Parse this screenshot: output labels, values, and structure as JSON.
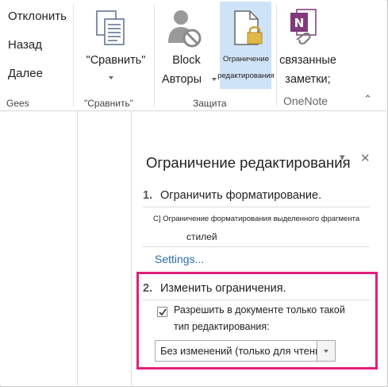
{
  "ribbon": {
    "left_commands": [
      "Отклонить",
      "Назад",
      "Далее"
    ],
    "group_gees": "Gees",
    "compare": {
      "label": "\"Сравнить\"",
      "group": "\"Сравнить\""
    },
    "block_authors": {
      "line1": "Block",
      "line2": "Авторы"
    },
    "restrict": {
      "line1": "Ограничение",
      "line2": "редактирования"
    },
    "protect_group": "Защита",
    "linked_notes": {
      "line1": "связанные",
      "line2": "заметки;"
    },
    "onenote_group": "OneNote"
  },
  "pane": {
    "title": "Ограничение редактирования",
    "step1": {
      "number": "1.",
      "title": "Ограничить форматирование."
    },
    "format_text": "C] Ограничение форматирования выделенного фрагмента",
    "styles": "стилей",
    "settings_link": "Settings...",
    "step2": {
      "number": "2.",
      "title": "Изменить ограничения."
    },
    "checkbox": {
      "checked": true,
      "line1": "Разрешить в документе только такой",
      "line2": "тип редактирования:"
    },
    "dropdown_value": "Без изменений (только для чтения)"
  },
  "colors": {
    "highlight": "#e0207a",
    "link": "#2b6cb0",
    "onenote": "#80397b"
  }
}
